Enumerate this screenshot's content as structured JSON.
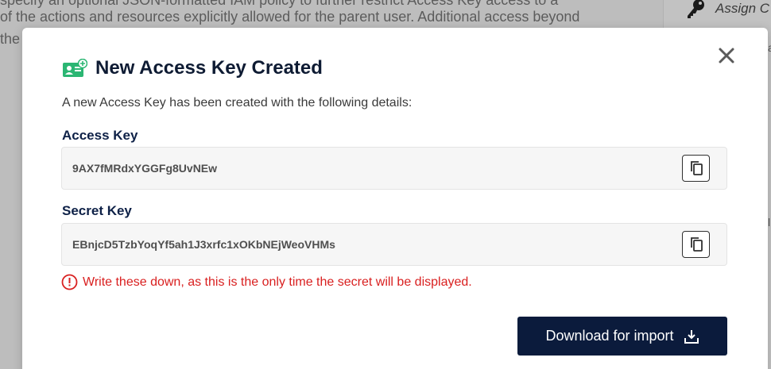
{
  "background": {
    "lines": [
      "specify an optional JSON-formatted IAM policy to further restrict Access Key access to a",
      "of the actions and resources explicitly allowed for the parent user. Additional access beyond",
      "the p"
    ],
    "sidebar_item": "Assign C"
  },
  "modal": {
    "title": "New Access Key Created",
    "intro": "A new Access Key has been created with the following details:",
    "access_key": {
      "label": "Access Key",
      "value": "9AX7fMRdxYGGFg8UvNEw"
    },
    "secret_key": {
      "label": "Secret Key",
      "value": "EBnjcD5TzbYoqYf5ah1J3xrfc1xOKbNEjWeoVHMs"
    },
    "warning": "Write these down, as this is the only time the secret will be displayed.",
    "download_button": "Download for import",
    "icons": {
      "title": "access-key-icon",
      "close": "close-icon",
      "copy": "copy-icon",
      "warning": "alert-circle-icon",
      "download": "download-icon"
    },
    "colors": {
      "primary": "#0b1b3c",
      "label": "#0e2147",
      "warning": "#d92020",
      "icon_accent": "#2bb673"
    }
  }
}
